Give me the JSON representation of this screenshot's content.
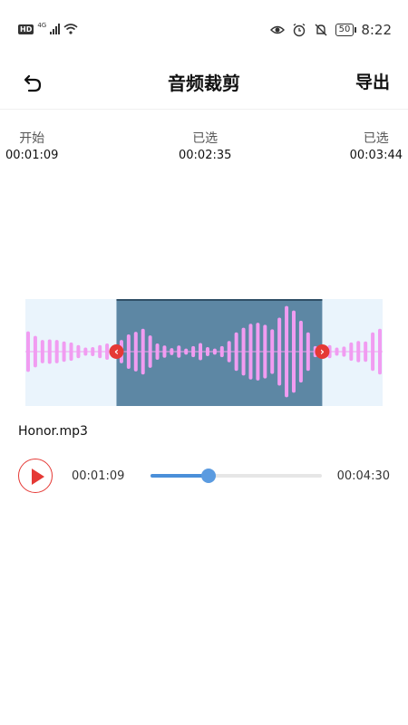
{
  "status": {
    "hd": "HD",
    "network": "4G",
    "battery": "50",
    "time": "8:22"
  },
  "header": {
    "title": "音频裁剪",
    "export_label": "导出"
  },
  "times": {
    "start_label": "开始",
    "start_value": "00:01:09",
    "selected_label": "已选",
    "selected_value": "00:02:35",
    "end_label": "已选",
    "end_value": "00:03:44"
  },
  "waveform": {
    "selection_start_fraction": 0.255,
    "selection_end_fraction": 0.831,
    "amplitudes": [
      0.4,
      0.31,
      0.23,
      0.24,
      0.23,
      0.2,
      0.18,
      0.13,
      0.08,
      0.09,
      0.13,
      0.16,
      0.08,
      0.23,
      0.34,
      0.39,
      0.45,
      0.32,
      0.16,
      0.12,
      0.07,
      0.12,
      0.06,
      0.11,
      0.17,
      0.09,
      0.06,
      0.11,
      0.21,
      0.38,
      0.47,
      0.55,
      0.57,
      0.53,
      0.44,
      0.67,
      0.9,
      0.81,
      0.61,
      0.38,
      0.11,
      0.07,
      0.13,
      0.08,
      0.1,
      0.18,
      0.21,
      0.2,
      0.38,
      0.45
    ]
  },
  "file": {
    "name": "Honor.mp3"
  },
  "player": {
    "current_time": "00:01:09",
    "total_time": "00:04:30",
    "progress": 0.34
  },
  "colors": {
    "accent": "#e53935",
    "progress": "#4a8fd9",
    "wave_bar": "#f19cf1",
    "wave_bg": "#eaf4fc",
    "selection": "#5d87a4"
  }
}
